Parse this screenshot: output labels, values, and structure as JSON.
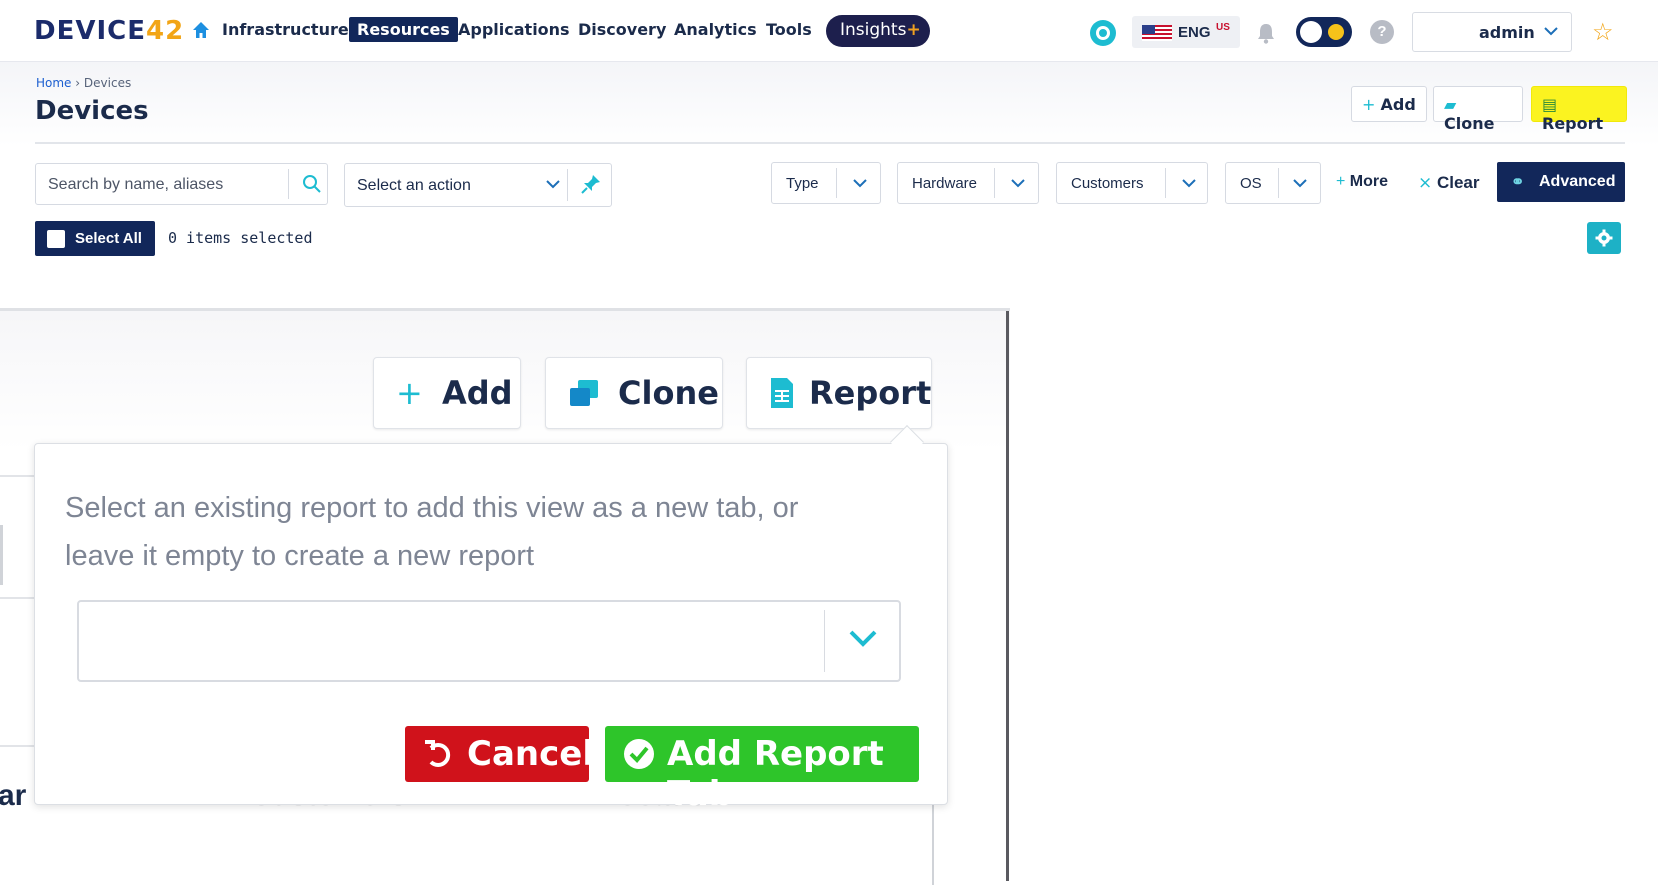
{
  "brand": {
    "logo_text": "DEVICE",
    "logo_num": "42"
  },
  "nav": {
    "items": [
      "Infrastructure",
      "Resources",
      "Applications",
      "Discovery",
      "Analytics",
      "Tools"
    ],
    "active": "Resources",
    "insights_label": "Insights",
    "insights_plus": "+",
    "lang": "ENG",
    "lang_region": "US",
    "help": "?",
    "user": "admin"
  },
  "breadcrumb": {
    "home": "Home",
    "sep": "›",
    "current": "Devices"
  },
  "page_title": "Devices",
  "header_buttons": {
    "add": "Add",
    "clone": "Clone",
    "report": "Report"
  },
  "filters": {
    "search_placeholder": "Search by name, aliases",
    "action_placeholder": "Select an action",
    "dropdowns": [
      "Type",
      "Hardware",
      "Customers",
      "OS"
    ],
    "more": "More",
    "more_prefix": "+",
    "clear": "Clear",
    "advanced": "Advanced"
  },
  "selection": {
    "select_all": "Select All",
    "count_text": "0 items selected"
  },
  "zoom": {
    "buttons": {
      "add": "Add",
      "clone": "Clone",
      "report": "Report"
    },
    "popup_message": "Select an existing report to add this view as a new tab, or leave it empty to create a new report",
    "select_value": "",
    "cancel": "Cancel",
    "add_report_tab": "Add Report Tab",
    "ghost_text": [
      "ar",
      "Customers",
      "Location"
    ]
  },
  "colors": {
    "navy": "#12275a",
    "teal": "#1dbcd1",
    "highlight": "#fbf320",
    "cancel": "#d0121b",
    "add": "#2ec52a"
  }
}
